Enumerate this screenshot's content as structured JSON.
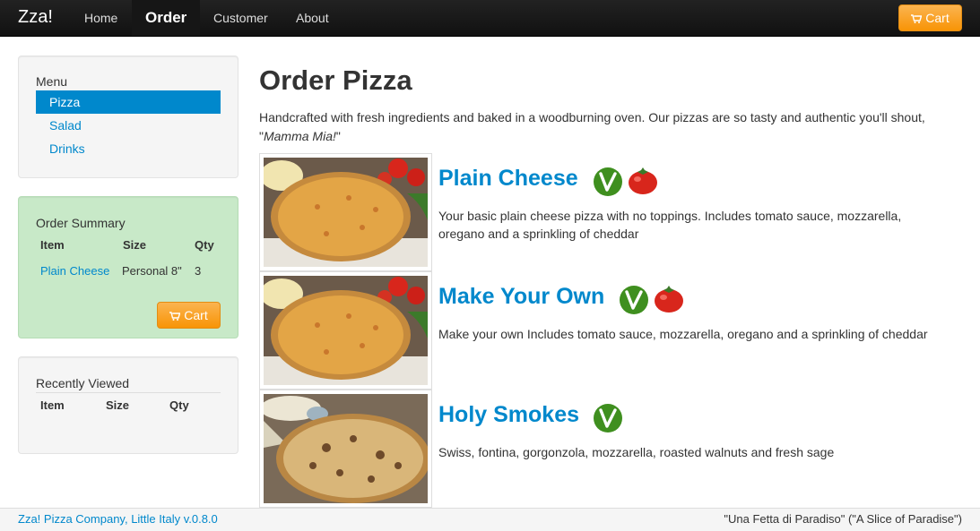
{
  "navbar": {
    "brand": "Zza!",
    "links": [
      "Home",
      "Order",
      "Customer",
      "About"
    ],
    "active": "Order",
    "cart_label": "Cart",
    "accent": "#f89406"
  },
  "menu": {
    "title": "Menu",
    "items": [
      "Pizza",
      "Salad",
      "Drinks"
    ],
    "selected": "Pizza"
  },
  "order_summary": {
    "title": "Order Summary",
    "columns": [
      "Item",
      "Size",
      "Qty"
    ],
    "rows": [
      {
        "item": "Plain Cheese",
        "size": "Personal 8\"",
        "qty": "3"
      }
    ],
    "cart_label": "Cart"
  },
  "recently_viewed": {
    "title": "Recently Viewed",
    "columns": [
      "Item",
      "Size",
      "Qty"
    ]
  },
  "main": {
    "title": "Order Pizza",
    "intro_text": "Handcrafted with fresh ingredients and baked in a woodburning oven. Our pizzas are so tasty and authentic you'll shout, \"",
    "intro_em": "Mamma Mia!",
    "intro_end": "\"",
    "products": [
      {
        "name": "Plain Cheese",
        "description": "Your basic plain cheese pizza with no toppings. Includes tomato sauce, mozzarella, oregano and a sprinkling of cheddar",
        "badges": [
          "vegetarian-icon",
          "tomato-icon"
        ]
      },
      {
        "name": "Make Your Own",
        "description": "Make your own Includes tomato sauce, mozzarella, oregano and a sprinkling of cheddar",
        "badges": [
          "vegetarian-icon",
          "tomato-icon"
        ]
      },
      {
        "name": "Holy Smokes",
        "description": "Swiss, fontina, gorgonzola, mozzarella, roasted walnuts and fresh sage",
        "badges": [
          "vegetarian-icon"
        ]
      }
    ]
  },
  "footer": {
    "left": "Zza! Pizza Company, Little Italy v.0.8.0",
    "right": "\"Una Fetta di Paradiso\" (\"A Slice of Paradise\")"
  },
  "colors": {
    "link": "#0088cc",
    "summary_bg": "#c8e9c8",
    "veg_green": "#3f8f1f",
    "tomato_red": "#d8261c"
  }
}
